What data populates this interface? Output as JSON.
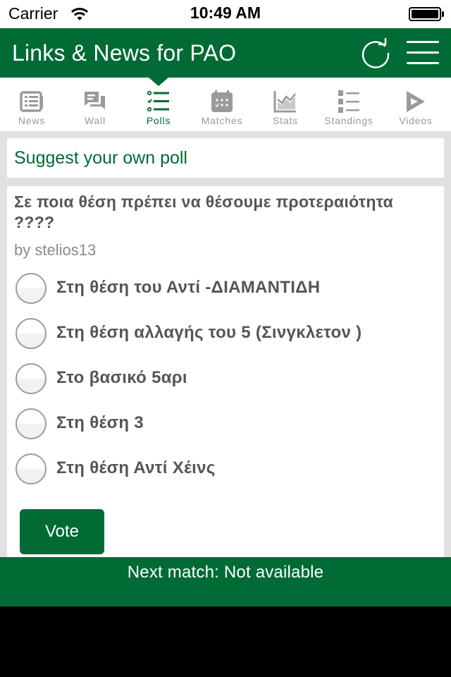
{
  "status_bar": {
    "carrier": "Carrier",
    "time": "10:49 AM",
    "wifi_icon": "wifi-icon",
    "battery_icon": "battery-full-icon"
  },
  "nav": {
    "title": "Links & News for PAO",
    "refresh_icon": "refresh-icon",
    "menu_icon": "hamburger-menu-icon"
  },
  "tabs": [
    {
      "label": "News",
      "icon": "newspaper-icon",
      "active": false
    },
    {
      "label": "Wall",
      "icon": "chat-bubbles-icon",
      "active": false
    },
    {
      "label": "Polls",
      "icon": "checklist-icon",
      "active": true
    },
    {
      "label": "Matches",
      "icon": "calendar-icon",
      "active": false
    },
    {
      "label": "Stats",
      "icon": "chart-icon",
      "active": false
    },
    {
      "label": "Standings",
      "icon": "numbered-list-icon",
      "active": false
    },
    {
      "label": "Videos",
      "icon": "play-icon",
      "active": false
    }
  ],
  "suggest": {
    "label": "Suggest your own poll"
  },
  "poll": {
    "question": "Σε ποια θέση πρέπει να θέσουμε προτεραιότητα ????",
    "author": "by stelios13",
    "options": [
      {
        "label": "Στη θέση του Αντί -ΔΙΑΜΑΝΤΙΔΗ",
        "selected": false
      },
      {
        "label": "Στη θέση αλλαγής του 5 (Σινγκλετον )",
        "selected": false
      },
      {
        "label": "Στο βασικό 5αρι",
        "selected": false
      },
      {
        "label": "Στη θέση 3",
        "selected": false
      },
      {
        "label": "Στη θέση Αντί Χέινς",
        "selected": false
      }
    ],
    "vote_label": "Vote"
  },
  "footer": {
    "text": "Next match: Not available"
  },
  "colors": {
    "brand_green": "#006b35",
    "tab_inactive": "#9a9a9a",
    "background": "#e1e1e1"
  }
}
